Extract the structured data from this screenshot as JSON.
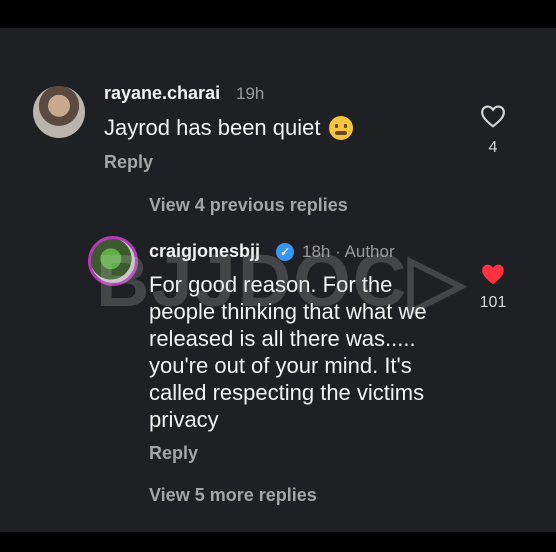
{
  "comments": [
    {
      "username": "rayane.charai",
      "time": "19h",
      "text": "Jayrod has been quiet",
      "emoji": "grimacing-face",
      "reply_label": "Reply",
      "likes": "4",
      "liked": false
    },
    {
      "username": "craigjonesbjj",
      "verified": true,
      "time": "18h · Author",
      "text": "For good reason. For the people thinking that what we released is all there was..... you're out of your mind. It's called respecting the victims privacy",
      "reply_label": "Reply",
      "likes": "101",
      "liked": true
    }
  ],
  "view_previous_replies": "View 4 previous replies",
  "view_more_replies": "View 5 more replies",
  "watermark": "BJJDOC",
  "colors": {
    "background": "#1f2023",
    "heart_liked": "#ff3040",
    "verified": "#3797f0",
    "avatar_ring": "#b43ab8"
  }
}
